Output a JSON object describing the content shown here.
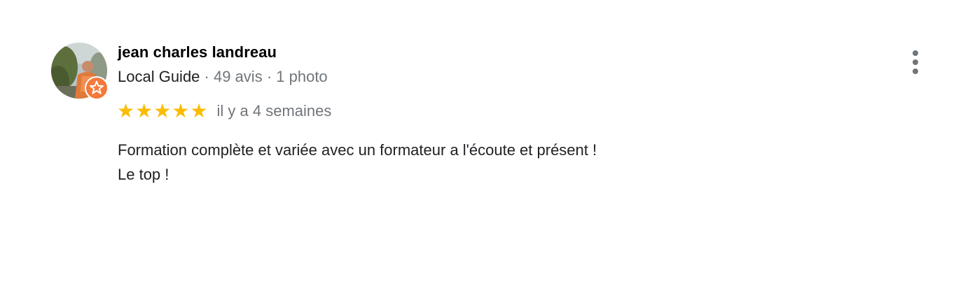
{
  "review": {
    "author": {
      "name": "jean charles landreau",
      "avatar_icon": "user-photo-avatar",
      "badge_icon": "local-guide-star-icon",
      "badge_color": "#f4793b"
    },
    "meta": {
      "guide_label": "Local Guide",
      "separator": " · ",
      "reviews_count": "49 avis",
      "photos_count": "1 photo"
    },
    "rating": {
      "stars": 5,
      "max": 5,
      "star_color": "#fbbc04"
    },
    "date": "il y a 4 semaines",
    "text": {
      "line1": "Formation complète et variée avec un formateur a l'écoute et présent !",
      "line2": "Le top !"
    },
    "menu_icon": "more-vert-icon"
  }
}
